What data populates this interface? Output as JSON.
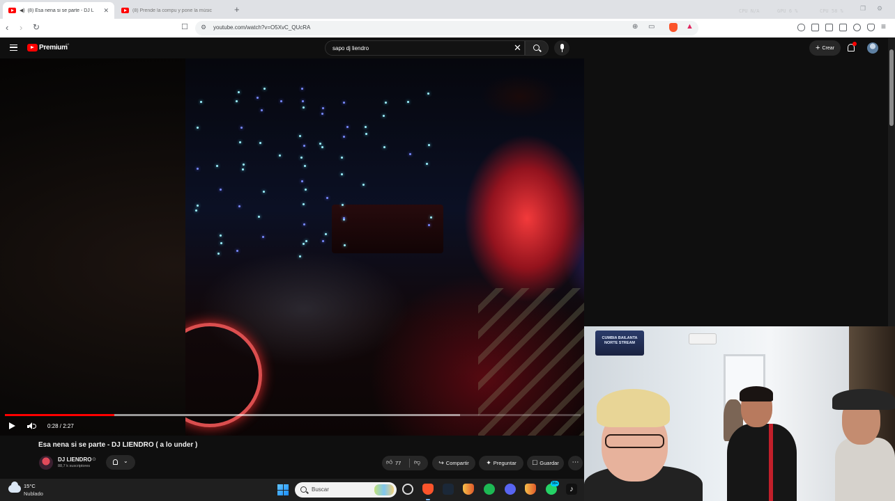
{
  "browser": {
    "tabs": [
      {
        "title": "(8) Esa nena si se parte - DJ L",
        "active": true,
        "playing_audio": true
      },
      {
        "title": "(8) Prende la compu y pone la músic",
        "active": false,
        "playing_audio": false
      }
    ],
    "new_tab_label": "+",
    "system_stats": [
      "CPU N/A",
      "GPU 6 %",
      "CPU 58 %"
    ],
    "url": "youtube.com/watch?v=O5XvC_QUcRA",
    "icons": [
      "back-icon",
      "forward-icon",
      "reload-icon",
      "bookmark-icon",
      "site-info-icon",
      "zoom-icon",
      "cast-icon",
      "brave-shield-icon",
      "brave-rewards-icon",
      "extensions-icon",
      "media-icon",
      "sidebar-icon",
      "wallet-icon",
      "leo-icon",
      "vpn-icon",
      "menu-icon"
    ]
  },
  "youtube": {
    "logo_label": "Premium",
    "region_label": "AR",
    "search_query": "sapo dj liendro",
    "create_label": "Crear",
    "accent_color": "#ff0000"
  },
  "player": {
    "time_display": "0:28 / 2:27",
    "progress_fraction": 0.19,
    "buffered_fraction": 0.79
  },
  "video": {
    "title": "Esa nena si se parte - DJ LIENDRO ( a lo under )",
    "channel_name": "DJ LIENDRO",
    "verified_mark": "⊙",
    "subscribers": "88,7 k suscriptores",
    "likes": "77",
    "actions": {
      "share": "Compartir",
      "ask": "Preguntar",
      "save": "Guardar"
    }
  },
  "webcam": {
    "sign_text": "CUMBIA BAILANTA NORTE STREAM"
  },
  "taskbar": {
    "temperature": "15°C",
    "condition": "Nublado",
    "search_placeholder": "Buscar",
    "whatsapp_badge": "99+"
  }
}
